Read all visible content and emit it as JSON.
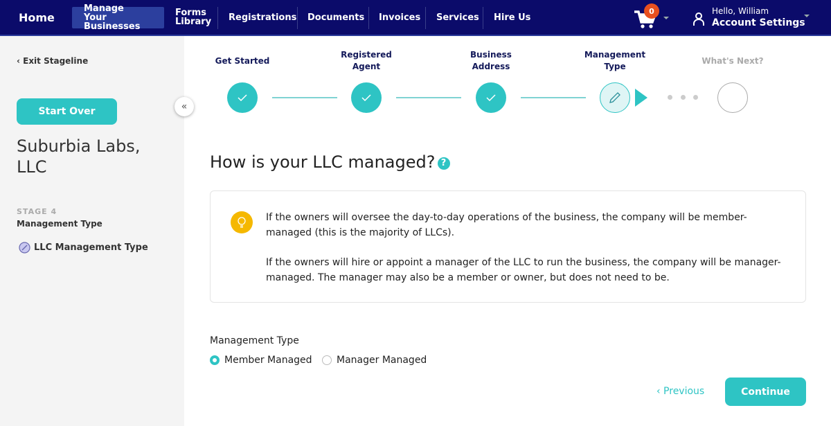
{
  "nav": {
    "home": "Home",
    "manage_l1": "Manage",
    "manage_l2": "Your Businesses",
    "forms_l1": "Forms",
    "forms_l2": "Library",
    "registrations": "Registrations",
    "documents": "Documents",
    "invoices": "Invoices",
    "services": "Services",
    "hire": "Hire Us",
    "cart_count": "0",
    "greeting": "Hello, William",
    "account": "Account Settings"
  },
  "sidebar": {
    "exit": "‹ Exit Stageline",
    "start_over": "Start Over",
    "company_l1": "Suburbia Labs,",
    "company_l2": "LLC",
    "stage": "STAGE 4",
    "stage_name": "Management Type",
    "item": "LLC Management Type"
  },
  "stepper": {
    "steps": [
      {
        "l1": "Get Started",
        "l2": "",
        "status": "complete"
      },
      {
        "l1": "Registered",
        "l2": "Agent",
        "status": "complete"
      },
      {
        "l1": "Business",
        "l2": "Address",
        "status": "complete"
      },
      {
        "l1": "Management",
        "l2": "Type",
        "status": "current"
      },
      {
        "l1": "What's Next?",
        "l2": "",
        "status": "upcoming"
      }
    ]
  },
  "main": {
    "title": "How is your LLC managed?",
    "info_p1": "If the owners will oversee the day-to-day operations of the business, the company will be member-managed (this is the majority of LLCs).",
    "info_p2": "If the owners will hire or appoint a manager of the LLC to run the business, the company will be manager-managed. The manager may also be a member or owner, but does not need to be.",
    "field_label": "Management Type",
    "options": [
      "Member Managed",
      "Manager Managed"
    ],
    "selected": "Member Managed",
    "previous": "‹ Previous",
    "continue": "Continue"
  },
  "colors": {
    "nav": "#0b0b6a",
    "accent": "#2ec4c4",
    "tip": "#f5b800",
    "badge": "#e8501f"
  }
}
